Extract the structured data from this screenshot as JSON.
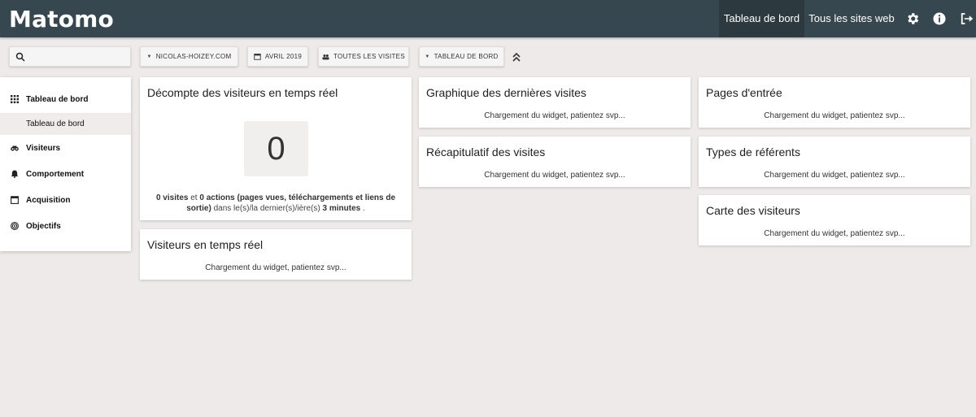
{
  "header": {
    "logo": "Matomo",
    "nav": [
      {
        "label": "Tableau de bord",
        "active": true
      },
      {
        "label": "Tous les sites web",
        "active": false
      }
    ],
    "icons": [
      "gear-icon",
      "info-icon",
      "logout-icon"
    ]
  },
  "filters": {
    "search_placeholder": "",
    "site": "NICOLAS-HOIZEY.COM",
    "period": "AVRIL 2019",
    "segment": "TOUTES LES VISITES",
    "dashboard": "TABLEAU DE BORD"
  },
  "sidebar": {
    "items": [
      {
        "label": "Tableau de bord",
        "icon": "grid-icon"
      },
      {
        "label": "Visiteurs",
        "icon": "binoculars-icon"
      },
      {
        "label": "Comportement",
        "icon": "bell-icon"
      },
      {
        "label": "Acquisition",
        "icon": "calendar-icon"
      },
      {
        "label": "Objectifs",
        "icon": "target-icon"
      }
    ],
    "subitem": "Tableau de bord"
  },
  "widgets": {
    "realtime_counter": {
      "title": "Décompte des visiteurs en temps réel",
      "value": "0",
      "visits": "0 visites",
      "and": "et",
      "actions": "0 actions (pages vues, téléchargements et liens de sortie)",
      "in_last": "dans le(s)/la dernier(s)/ière(s)",
      "minutes": "3 minutes",
      "dot": "."
    },
    "realtime_visitors": {
      "title": "Visiteurs en temps réel",
      "status": "Chargement du widget, patientez svp..."
    },
    "last_visits_graph": {
      "title": "Graphique des dernières visites",
      "status": "Chargement du widget, patientez svp..."
    },
    "visits_summary": {
      "title": "Récapitulatif des visites",
      "status": "Chargement du widget, patientez svp..."
    },
    "entry_pages": {
      "title": "Pages d'entrée",
      "status": "Chargement du widget, patientez svp..."
    },
    "referrer_types": {
      "title": "Types de référents",
      "status": "Chargement du widget, patientez svp..."
    },
    "visitor_map": {
      "title": "Carte des visiteurs",
      "status": "Chargement du widget, patientez svp..."
    }
  },
  "colors": {
    "header_bg": "#37474f",
    "header_active": "#2c3a40",
    "page_bg": "#eeeaea"
  }
}
